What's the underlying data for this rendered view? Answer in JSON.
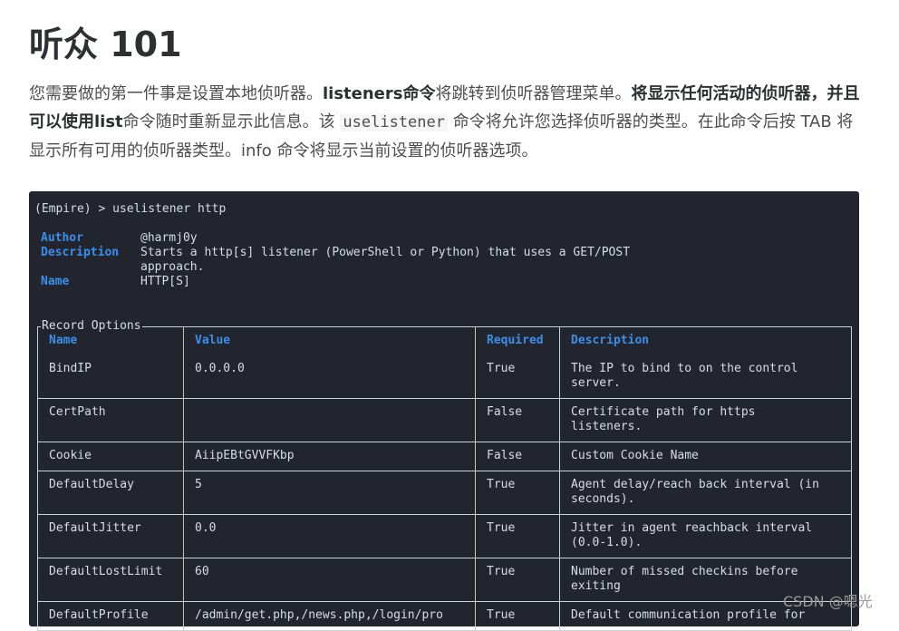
{
  "heading": "听众 101",
  "paragraph": {
    "s1": "您需要做的第一件事是设置本地侦听器。",
    "s2_bold": "listeners命令",
    "s3": "将跳转到侦听器管理菜单。",
    "s4_bold": "将显示任何活动的侦听器，并且可以使用list",
    "s5": "命令随时重新显示此信息。该 ",
    "s6_code": "uselistener",
    "s7": " 命令将允许您选择侦听器的类型。在此命令后按 TAB 将显示所有可用的侦听器类型。info 命令将显示当前设置的侦听器选项。"
  },
  "terminal": {
    "prompt": "(Empire) > uselistener http",
    "info": [
      {
        "key": "Author",
        "value": "@harmj0y"
      },
      {
        "key": "Description",
        "value": "Starts a http[s] listener (PowerShell or Python) that uses a GET/POST\napproach."
      },
      {
        "key": "Name",
        "value": "HTTP[S]"
      }
    ],
    "table_caption": "Record Options",
    "headers": [
      "Name",
      "Value",
      "Required",
      "Description"
    ],
    "rows": [
      [
        "BindIP",
        "0.0.0.0",
        "True",
        "The IP to bind to on the control\nserver."
      ],
      [
        "CertPath",
        "",
        "False",
        "Certificate path for https\nlisteners."
      ],
      [
        "Cookie",
        "AiipEBtGVVFKbp",
        "False",
        "Custom Cookie Name"
      ],
      [
        "DefaultDelay",
        "5",
        "True",
        "Agent delay/reach back interval (in\nseconds)."
      ],
      [
        "DefaultJitter",
        "0.0",
        "True",
        "Jitter in agent reachback interval\n(0.0-1.0)."
      ],
      [
        "DefaultLostLimit",
        "60",
        "True",
        "Number of missed checkins before\nexiting"
      ],
      [
        "DefaultProfile",
        "/admin/get.php,/news.php,/login/pro",
        "True",
        "Default communication profile for"
      ]
    ]
  },
  "watermark": "CSDN @嗯光"
}
